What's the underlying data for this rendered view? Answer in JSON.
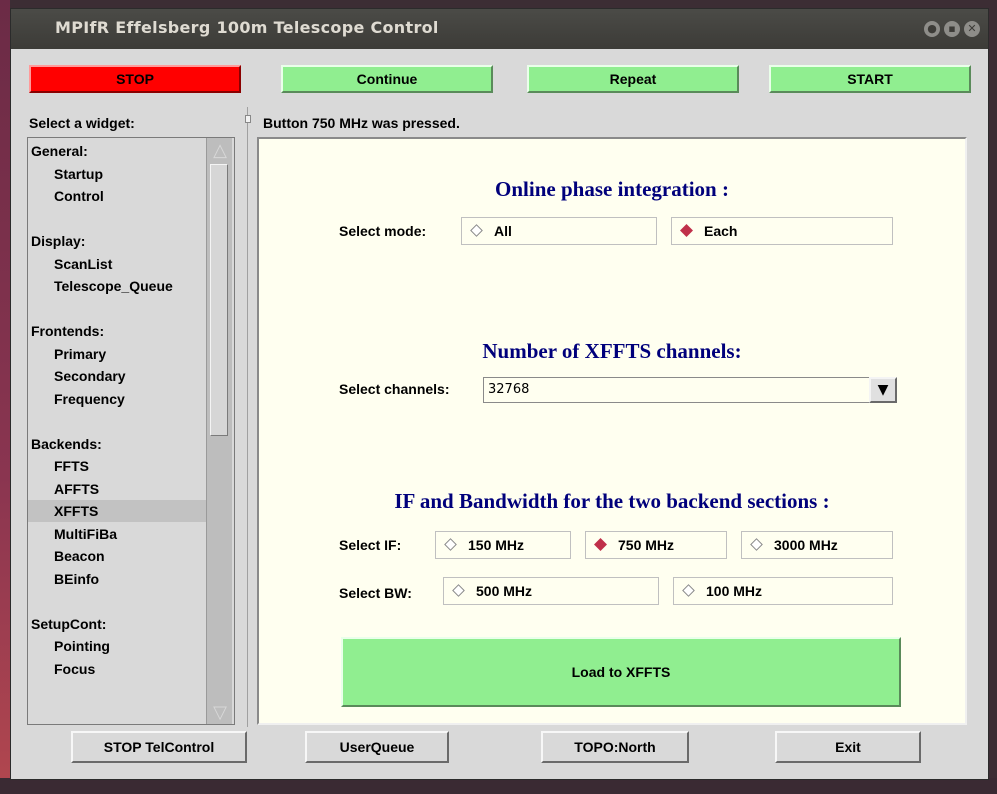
{
  "window": {
    "title": "MPIfR Effelsberg 100m Telescope Control",
    "controls": [
      "●",
      "▪",
      "✕"
    ]
  },
  "desktop_behind_text": "",
  "toolbar": {
    "stop": "STOP",
    "continue": "Continue",
    "repeat": "Repeat",
    "start": "START"
  },
  "sidebar": {
    "label": "Select a widget:",
    "items": [
      {
        "label": "General:",
        "kind": "category"
      },
      {
        "label": "Startup",
        "kind": "item"
      },
      {
        "label": "Control",
        "kind": "item"
      },
      {
        "label": "",
        "kind": "spacer"
      },
      {
        "label": "Display:",
        "kind": "category"
      },
      {
        "label": "ScanList",
        "kind": "item"
      },
      {
        "label": "Telescope_Queue",
        "kind": "item"
      },
      {
        "label": "",
        "kind": "spacer"
      },
      {
        "label": "Frontends:",
        "kind": "category"
      },
      {
        "label": "Primary",
        "kind": "item"
      },
      {
        "label": "Secondary",
        "kind": "item"
      },
      {
        "label": "Frequency",
        "kind": "item"
      },
      {
        "label": "",
        "kind": "spacer"
      },
      {
        "label": "Backends:",
        "kind": "category"
      },
      {
        "label": "FFTS",
        "kind": "item"
      },
      {
        "label": "AFFTS",
        "kind": "item"
      },
      {
        "label": "XFFTS",
        "kind": "item",
        "selected": true
      },
      {
        "label": "MultiFiBa",
        "kind": "item"
      },
      {
        "label": "Beacon",
        "kind": "item"
      },
      {
        "label": "BEinfo",
        "kind": "item"
      },
      {
        "label": "",
        "kind": "spacer"
      },
      {
        "label": "SetupCont:",
        "kind": "category"
      },
      {
        "label": "Pointing",
        "kind": "item"
      },
      {
        "label": "Focus",
        "kind": "item"
      }
    ]
  },
  "status": "Button 750 MHz was pressed.",
  "panel": {
    "heading_phase": "Online  phase  integration :",
    "mode_label": "Select mode:",
    "mode_options": [
      {
        "label": "All",
        "checked": false
      },
      {
        "label": "Each",
        "checked": true
      }
    ],
    "heading_channels": "Number of XFFTS channels:",
    "channels_label": "Select channels:",
    "channels_value": "32768",
    "channels_arrow": "▼",
    "heading_if": "IF and Bandwidth for the two backend sections :",
    "if_label": "Select IF:",
    "if_options": [
      {
        "label": "150 MHz",
        "checked": false
      },
      {
        "label": "750 MHz",
        "checked": true
      },
      {
        "label": "3000 MHz",
        "checked": false
      }
    ],
    "bw_label": "Select BW:",
    "bw_options": [
      {
        "label": "500 MHz",
        "checked": false
      },
      {
        "label": "100 MHz",
        "checked": false
      }
    ],
    "load_button": "Load to XFFTS"
  },
  "bottom": {
    "stop_telcontrol": "STOP TelControl",
    "userqueue": "UserQueue",
    "topo": "TOPO:North",
    "exit": "Exit"
  },
  "colors": {
    "stop": "#ff0000",
    "go": "#90ee90",
    "panel_bg": "#fffff0",
    "heading": "#00007b",
    "radio_on": "#c0304a"
  }
}
